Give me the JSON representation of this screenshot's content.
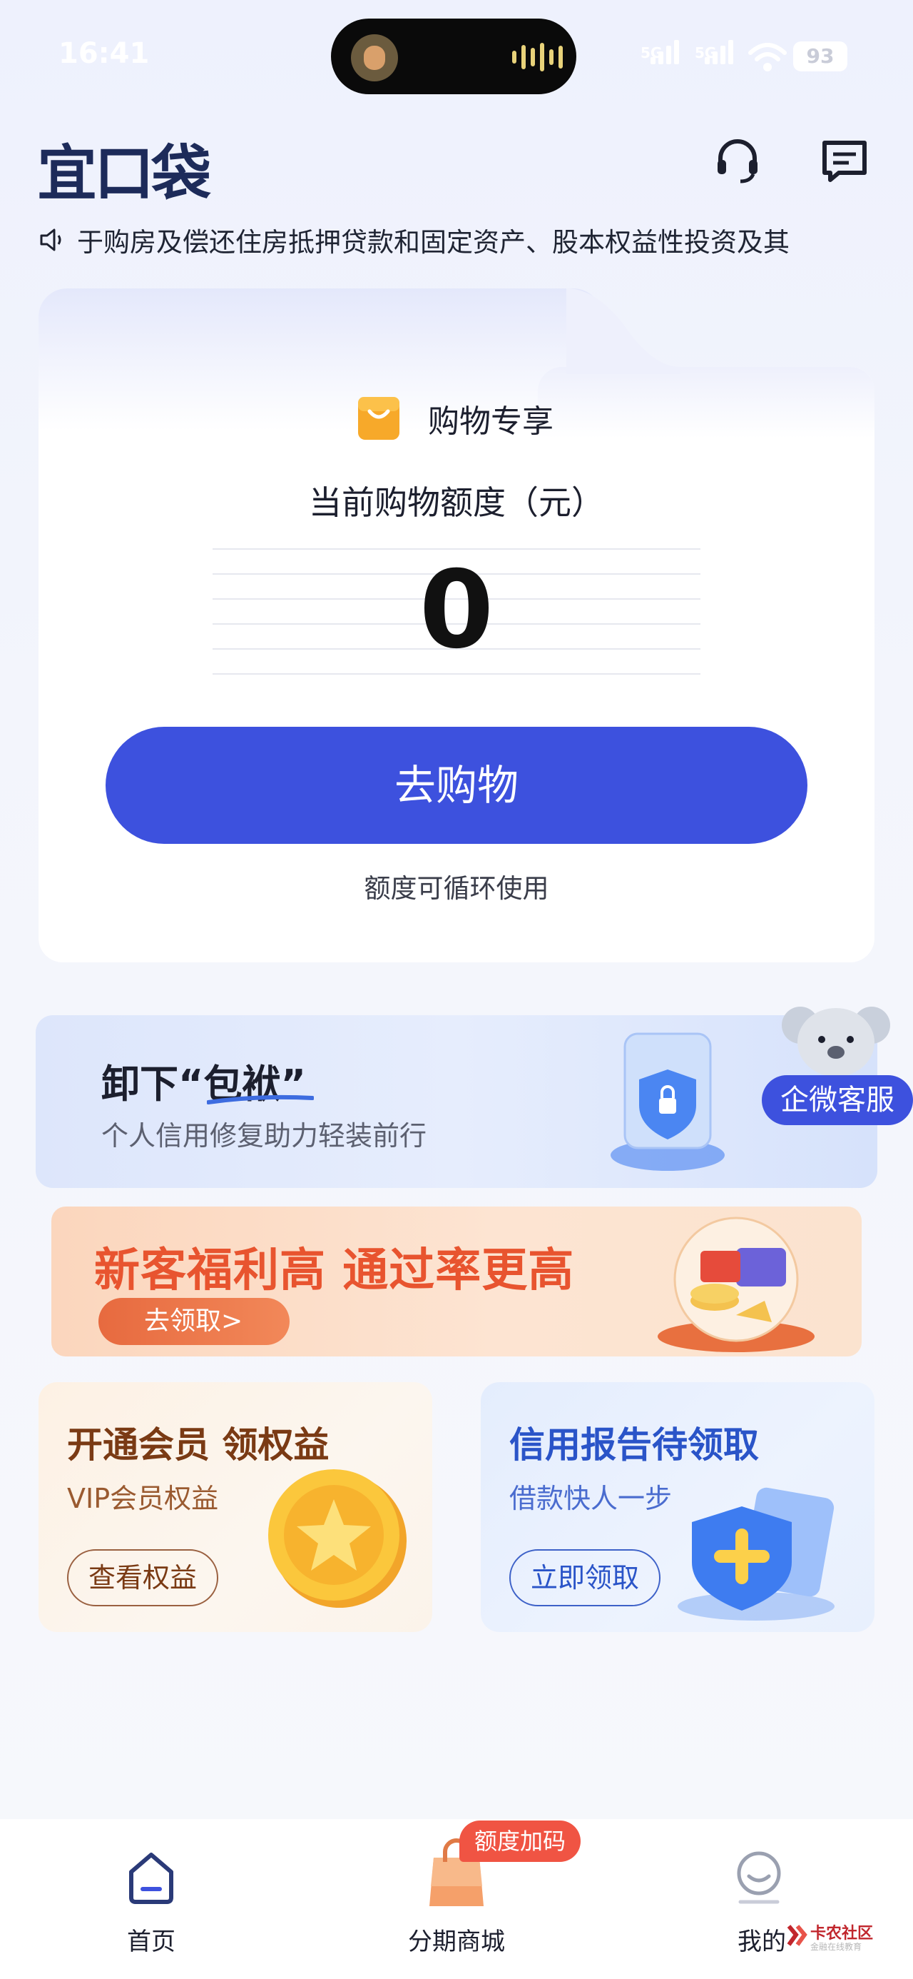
{
  "status_bar": {
    "time": "16:41",
    "network1": "5G",
    "network2": "5G",
    "battery": "93"
  },
  "header": {
    "logo": "宜口袋"
  },
  "notice": {
    "text": "于购房及偿还住房抵押贷款和固定资产、股本权益性投资及其"
  },
  "quota_card": {
    "shop_label": "购物专享",
    "quota_label": "当前购物额度（元）",
    "quota_value": "0",
    "go_button": "去购物",
    "cycle_note": "额度可循环使用"
  },
  "banner_relief": {
    "title": "卸下“包袱”",
    "subtitle": "个人信用修复助力轻装前行",
    "kefu_label": "企微客服"
  },
  "banner_newcustomer": {
    "title": "新客福利高 通过率更高",
    "button": "去领取>"
  },
  "tiles": [
    {
      "title": "开通会员 领权益",
      "subtitle": "VIP会员权益",
      "button": "查看权益"
    },
    {
      "title": "信用报告待领取",
      "subtitle": "借款快人一步",
      "button": "立即领取"
    }
  ],
  "tabbar": {
    "items": [
      {
        "label": "首页",
        "icon": "home-icon"
      },
      {
        "label": "分期商城",
        "icon": "shopping-bag-icon"
      },
      {
        "label": "我的",
        "icon": "profile-icon"
      }
    ],
    "promo_badge": "额度加码"
  },
  "watermark": {
    "text": "卡农社区",
    "sub": "金融在线教育"
  },
  "colors": {
    "primary": "#3d51de",
    "promo_red": "#f05443",
    "orange": "#e8542f"
  }
}
